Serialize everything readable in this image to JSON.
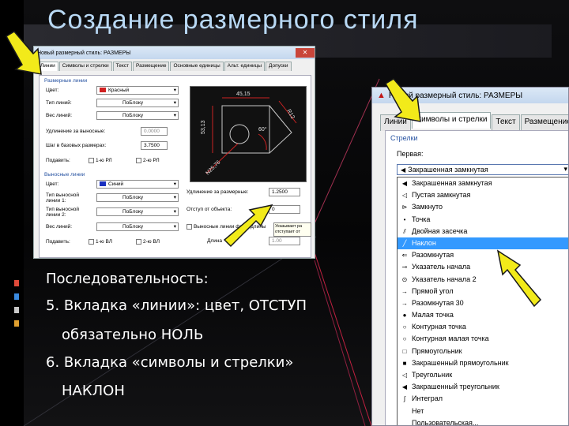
{
  "slide_title": "Создание размерного стиля",
  "colors": {
    "title": "#b8d8f4",
    "arrow": "#f2ea1a",
    "arrow_outline": "#1a1a1a",
    "selection": "#3399ff",
    "dim_lines": "#cc2222"
  },
  "dialog1": {
    "title": "Новый размерный стиль: РАЗМЕРЫ",
    "close": "✕",
    "tabs": [
      "Линии",
      "Символы и стрелки",
      "Текст",
      "Размещение",
      "Основные единицы",
      "Альт. единицы",
      "Допуски"
    ],
    "dim_group": "Размерные линии",
    "color_label": "Цвет:",
    "color_value": "Красный",
    "linetype_label": "Тип линий:",
    "linetype_value": "ПоБлоку",
    "lineweight_label": "Вес линий:",
    "lineweight_value": "ПоБлоку",
    "extend_label": "Удлинение за выносные:",
    "extend_value": "0.0000",
    "baseline_label": "Шаг в базовых размерах:",
    "baseline_value": "3.7500",
    "suppress_label": "Подавить:",
    "suppress_1": "1-ю РЛ",
    "suppress_2": "2-ю РЛ",
    "ext_group": "Выносные линии",
    "ext_color_label": "Цвет:",
    "ext_color_value": "Синий",
    "ext_lt1_label": "Тип выносной линии 1:",
    "ext_lt1_value": "ПоБлоку",
    "ext_lt2_label": "Тип выносной линии 2:",
    "ext_lt2_value": "ПоБлоку",
    "ext_lw_label": "Вес линий:",
    "ext_lw_value": "ПоБлоку",
    "ext_suppress_label": "Подавить:",
    "ext_suppress_1": "1-ю ВЛ",
    "ext_suppress_2": "2-ю ВЛ",
    "beyond_label": "Удлинение за размерные:",
    "beyond_value": "1.2500",
    "offset_label": "Отступ от объекта:",
    "offset_value": "0",
    "fixed_label": "Выносные линии фикс. длины",
    "length_label": "Длина",
    "length_value": "1.00",
    "tooltip": "Указывает ра отступает от",
    "preview_labels": {
      "top": "45,15",
      "left": "53,13",
      "right": "R12",
      "angle": "60°",
      "diag": "N25,76"
    }
  },
  "dialog2": {
    "title": "Новый размерный стиль: РАЗМЕРЫ",
    "tabs": [
      "Линии",
      "Символы и стрелки",
      "Текст",
      "Размещение"
    ],
    "group": "Стрелки",
    "first_label": "Первая:",
    "combo_value": "Закрашенная замкнутая",
    "items": [
      {
        "icon": "arrow-filled-icon",
        "glyph": "◀",
        "label": "Закрашенная замкнутая"
      },
      {
        "icon": "arrow-hollow-icon",
        "glyph": "◁",
        "label": "Пустая замкнутая"
      },
      {
        "icon": "arrow-closed-icon",
        "glyph": "⊳",
        "label": "Замкнуто"
      },
      {
        "icon": "dot-icon",
        "glyph": "•",
        "label": "Точка"
      },
      {
        "icon": "double-tick-icon",
        "glyph": "⫽",
        "label": "Двойная засечка"
      },
      {
        "icon": "oblique-icon",
        "glyph": "╱",
        "label": "Наклон"
      },
      {
        "icon": "open-arrow-icon",
        "glyph": "⇐",
        "label": "Разомкнутая"
      },
      {
        "icon": "origin-icon",
        "glyph": "⊸",
        "label": "Указатель начала"
      },
      {
        "icon": "origin2-icon",
        "glyph": "⊙",
        "label": "Указатель начала 2"
      },
      {
        "icon": "right-angle-icon",
        "glyph": "→",
        "label": "Прямой угол"
      },
      {
        "icon": "open30-icon",
        "glyph": "→",
        "label": "Разомкнутая 30"
      },
      {
        "icon": "small-dot-icon",
        "glyph": "●",
        "label": "Малая точка"
      },
      {
        "icon": "dot-blank-icon",
        "glyph": "○",
        "label": "Контурная точка"
      },
      {
        "icon": "dot-small-blank-icon",
        "glyph": "○",
        "label": "Контурная малая точка"
      },
      {
        "icon": "box-icon",
        "glyph": "□",
        "label": "Прямоугольник"
      },
      {
        "icon": "box-filled-icon",
        "glyph": "■",
        "label": "Закрашенный прямоугольник"
      },
      {
        "icon": "triangle-icon",
        "glyph": "◁",
        "label": "Треугольник"
      },
      {
        "icon": "triangle-filled-icon",
        "glyph": "◀",
        "label": "Закрашенный треугольник"
      },
      {
        "icon": "integral-icon",
        "glyph": "∫",
        "label": "Интеграл"
      },
      {
        "icon": "none-icon",
        "glyph": "",
        "label": "Нет"
      },
      {
        "icon": "user-icon",
        "glyph": "",
        "label": "Пользовательская..."
      }
    ],
    "selected_index": 5
  },
  "body_text": {
    "line1": "Последовательность:",
    "line2": "5. Вкладка «линии»: цвет, ОТСТУП",
    "line3": "обязательно НОЛЬ",
    "line4": "6. Вкладка «символы и стрелки»",
    "line5": "НАКЛОН"
  }
}
